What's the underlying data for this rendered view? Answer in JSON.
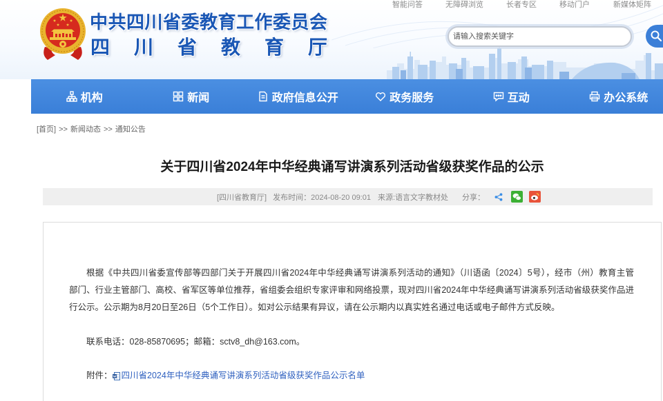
{
  "header": {
    "title_line1": "中共四川省委教育工作委员会",
    "title_line2": "四川省教育厅",
    "emblem_icon": "national-emblem-icon",
    "top_links": [
      "智能问答",
      "无障碍浏览",
      "长者专区",
      "移动门户",
      "新媒体矩阵"
    ],
    "search": {
      "placeholder": "请输入搜索关键字",
      "button_icon": "search-icon"
    }
  },
  "nav": [
    {
      "label": "机构",
      "icon": "org-chart-icon"
    },
    {
      "label": "新闻",
      "icon": "news-grid-icon"
    },
    {
      "label": "政府信息公开",
      "icon": "document-icon"
    },
    {
      "label": "政务服务",
      "icon": "service-heart-icon"
    },
    {
      "label": "互动",
      "icon": "chat-icon"
    },
    {
      "label": "办公系统",
      "icon": "printer-icon"
    }
  ],
  "breadcrumb": {
    "home": "[首页]",
    "separator": ">>",
    "items": [
      "新闻动态",
      "通知公告"
    ]
  },
  "article": {
    "title": "关于四川省2024年中华经典诵写讲演系列活动省级获奖作品的公示",
    "meta": {
      "publisher": "[四川省教育厅]",
      "publish_time_label": "发布时间：",
      "publish_time": "2024-08-20 09:01",
      "source_label": "来源:",
      "source": "语言文字教材处",
      "share_label": "分享：",
      "share_icons": [
        "share-icon",
        "wechat-icon",
        "weibo-icon"
      ]
    },
    "body_lines": [
      "根据《中共四川省委宣传部等四部门关于开展四川省2024年中华经典诵写讲演系列活动的通知》（川语函〔2024〕5号），经市（州）教育主管",
      "部门、行业主管部门、高校、省军区等单位推荐，省组委会组织专家评审和网络投票，现对四川省2024年中华经典诵写讲演系列活动省级获奖作品进",
      "行公示。公示期为8月20日至26日（5个工作日）。如对公示结果有异议，请在公示期内以真实姓名通过电话或电子邮件方式反映。"
    ],
    "contact": "联系电话：028-85870695；邮箱：sctv8_dh@163.com。",
    "attachment": {
      "label": "附件：",
      "icon": "word-document-icon",
      "name": "四川省2024年中华经典诵写讲演系列活动省级获奖作品公示名单"
    }
  },
  "colors": {
    "brand_blue": "#1a57b5",
    "nav_bg": "#3d82db",
    "link_blue": "#2d5fbf",
    "meta_bar_bg": "#efefef",
    "wechat_green": "#3cb034",
    "weibo_red": "#e8533a"
  }
}
